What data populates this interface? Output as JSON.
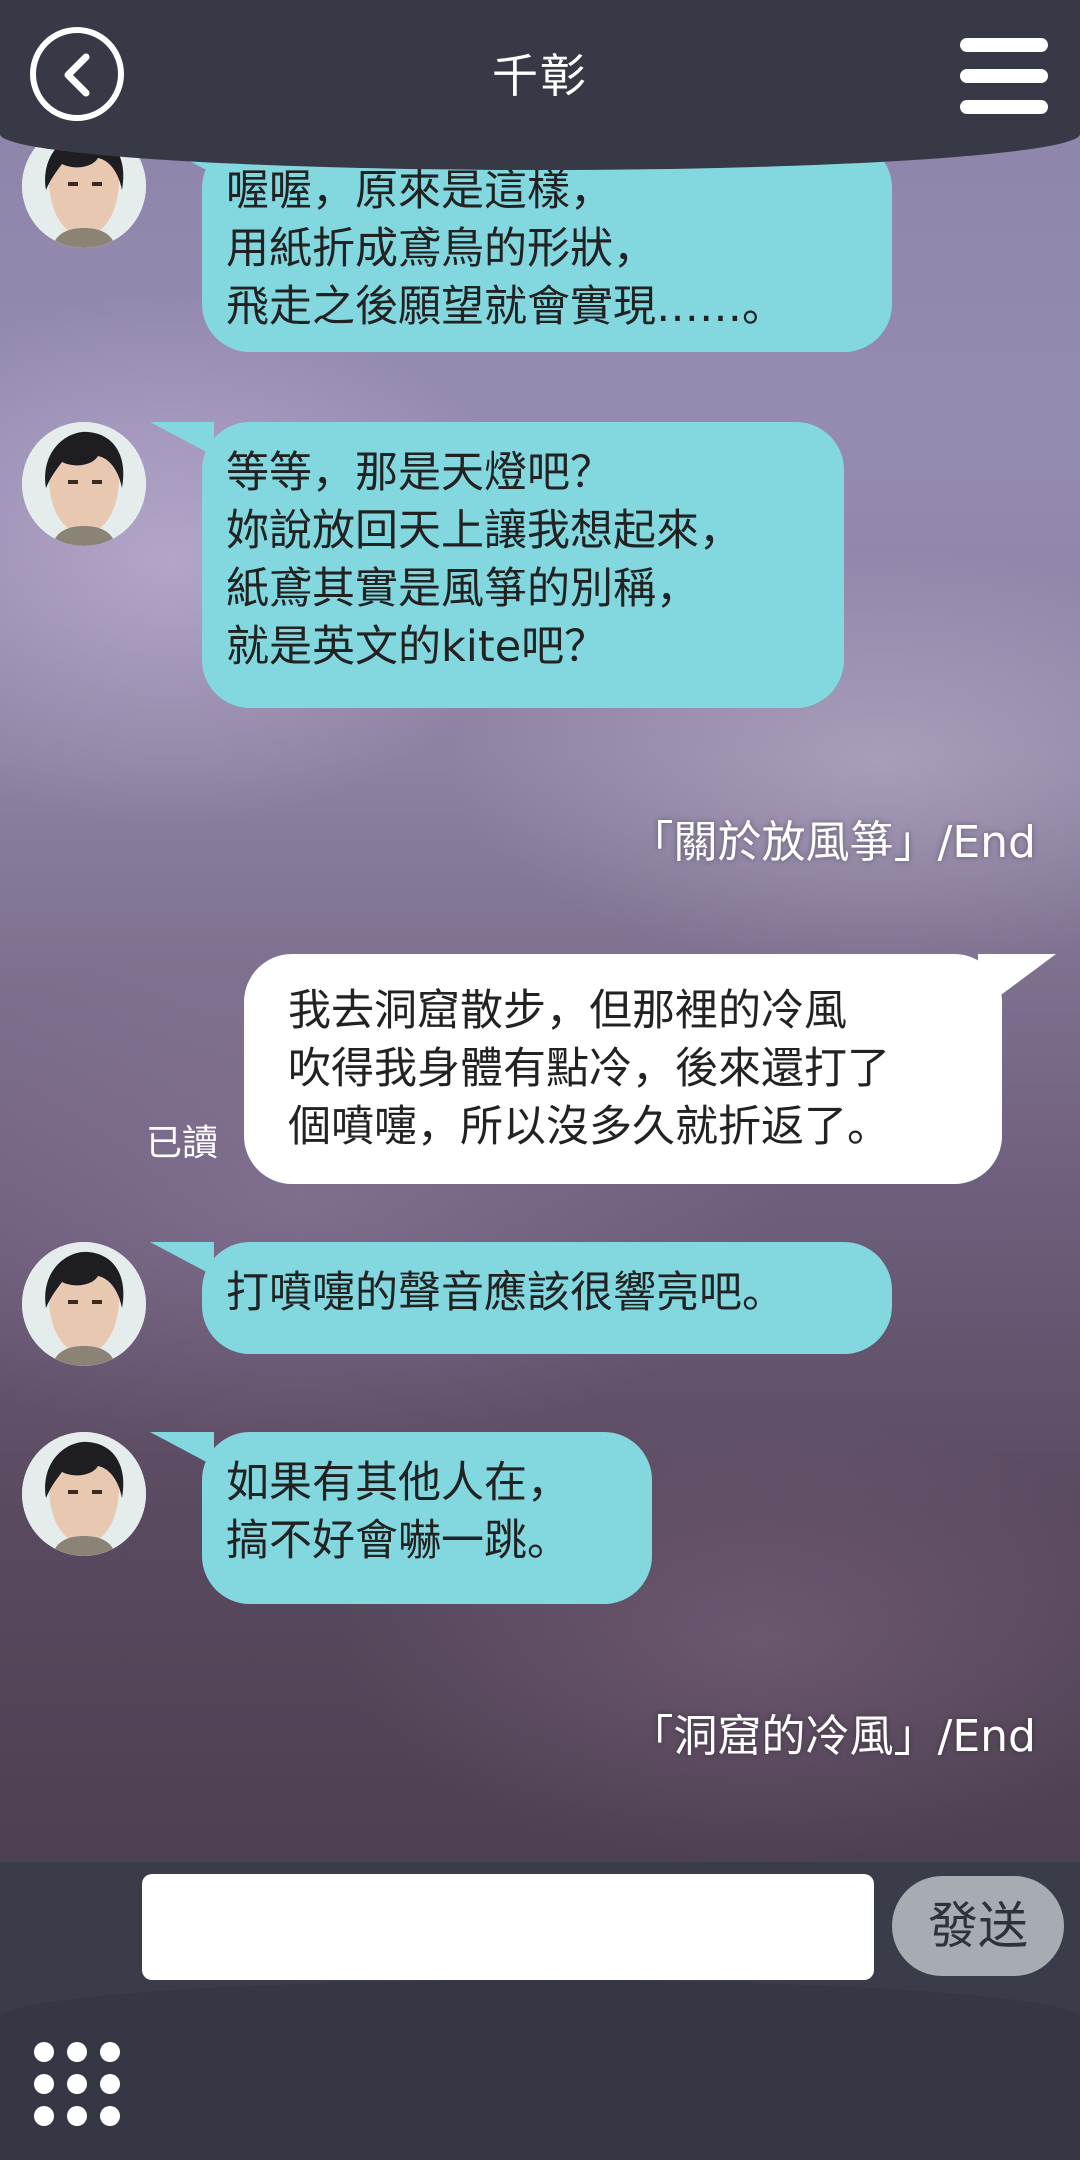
{
  "header": {
    "title": "千彰"
  },
  "messages": [
    {
      "text": "喔喔，原來是這樣，\n用紙折成鳶鳥的形狀，\n飛走之後願望就會實現……。"
    },
    {
      "text": "等等，那是天燈吧？\n妳說放回天上讓我想起來，\n紙鳶其實是風箏的別稱，\n就是英文的kite吧？"
    },
    {
      "text": "我去洞窟散步，但那裡的冷風\n吹得我身體有點冷，後來還打了\n個噴嚏，所以沒多久就折返了。"
    },
    {
      "text": "打噴嚏的聲音應該很響亮吧。"
    },
    {
      "text": "如果有其他人在，\n搞不好會嚇一跳。"
    }
  ],
  "end_labels": [
    "「關於放風箏」/End",
    "「洞窟的冷風」/End"
  ],
  "read_status": "已讀",
  "composer": {
    "placeholder": "",
    "send_label": "發送"
  },
  "colors": {
    "bubble_left": "#83d8df",
    "bubble_right": "#ffffff",
    "header_bg": "#373a46"
  },
  "icons": {
    "back": "chevron-left-icon",
    "menu": "hamburger-menu-icon",
    "apps": "grid-dots-icon"
  }
}
